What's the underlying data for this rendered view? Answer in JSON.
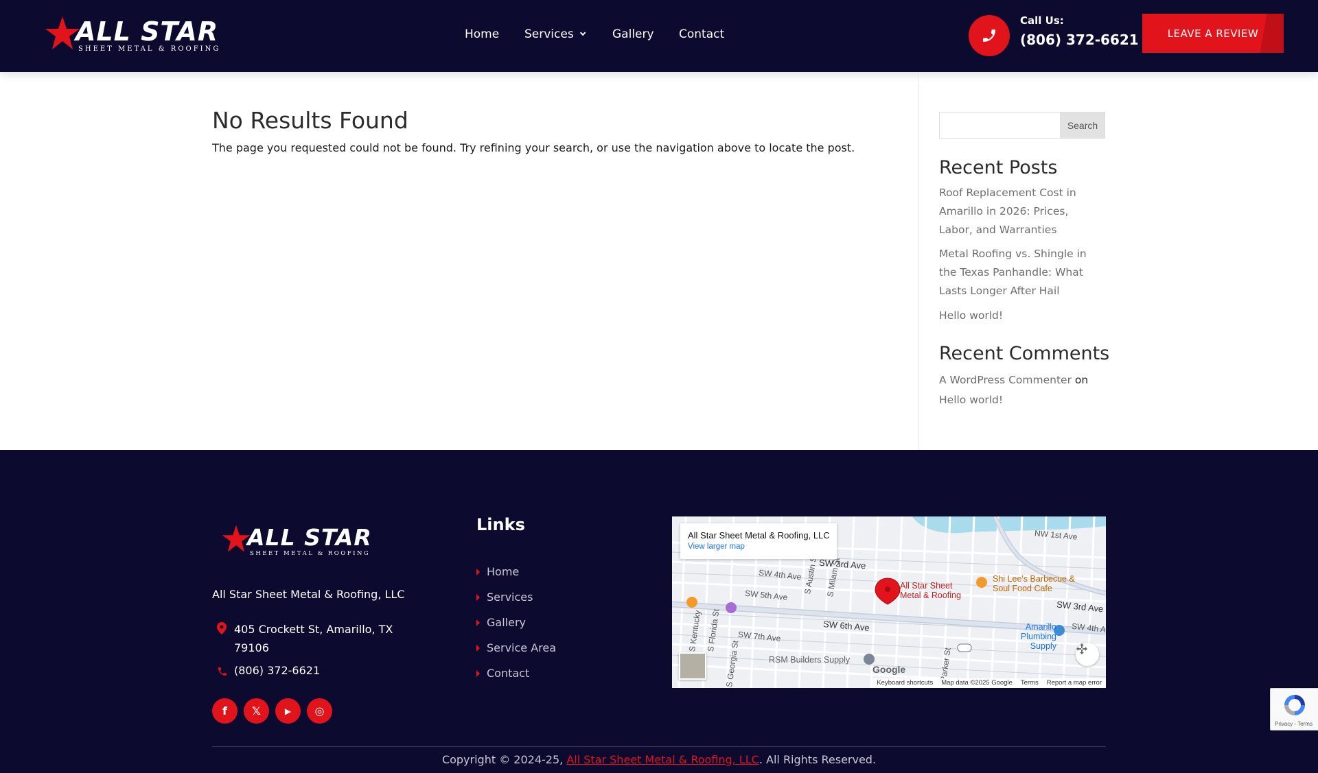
{
  "header": {
    "logo": {
      "brand": "ALL STAR",
      "tagline": "SHEET METAL & ROOFING"
    },
    "nav": [
      {
        "label": "Home"
      },
      {
        "label": "Services"
      },
      {
        "label": "Gallery"
      },
      {
        "label": "Contact"
      }
    ],
    "call_label": "Call Us:",
    "call_number": "(806) 372-6621",
    "review_button": "LEAVE A REVIEW"
  },
  "main": {
    "title": "No Results Found",
    "message": "The page you requested could not be found. Try refining your search, or use the navigation above to locate the post."
  },
  "sidebar": {
    "search_placeholder": "",
    "search_button": "Search",
    "recent_posts_heading": "Recent Posts",
    "recent_posts": [
      {
        "title": "Roof Replacement Cost in Amarillo in 2026: Prices, Labor, and Warranties"
      },
      {
        "title": "Metal Roofing vs. Shingle in the Texas Panhandle: What Lasts Longer After Hail"
      },
      {
        "title": "Hello world!"
      }
    ],
    "recent_comments_heading": "Recent Comments",
    "comment": {
      "author": "A WordPress Commenter",
      "connector": "on",
      "post": "Hello world!"
    }
  },
  "footer": {
    "logo": {
      "brand": "ALL STAR",
      "tagline": "SHEET METAL & ROOFING"
    },
    "company": "All Star Sheet Metal & Roofing, LLC",
    "address": "405 Crockett St, Amarillo, TX 79106",
    "phone": "(806) 372-6621",
    "links_heading": "Links",
    "links": [
      {
        "label": "Home"
      },
      {
        "label": "Services"
      },
      {
        "label": "Gallery"
      },
      {
        "label": "Service Area"
      },
      {
        "label": "Contact"
      }
    ],
    "socials": [
      {
        "icon": "facebook-icon",
        "glyph": "f"
      },
      {
        "icon": "x-icon",
        "glyph": "𝕏"
      },
      {
        "icon": "youtube-icon",
        "glyph": "▶"
      },
      {
        "icon": "instagram-icon",
        "glyph": "◎"
      }
    ],
    "map": {
      "place_name": "All Star Sheet Metal & Roofing, LLC",
      "view_larger": "View larger map",
      "streets": [
        "SW 3rd Ave",
        "SW 4th Ave",
        "SW 5th Ave",
        "SW 6th Ave",
        "SW 7th Ave",
        "S Austin St",
        "S Milam St",
        "S Georgia St",
        "S Florida St",
        "S Kentucky",
        "Parker St",
        "NW 1st Ave",
        "SW 3rd Ave",
        "SW 4th Ave"
      ],
      "pin_label": "All Star Sheet Metal & Roofing",
      "poi_bbq": "Shi Lee's Barbecue & Soul Food Cafe",
      "poi_plumbing": "Amarillo Plumbing Supply",
      "poi_rsm": "RSM Builders Supply",
      "google": "Google",
      "footer_items": [
        "Keyboard shortcuts",
        "Map data ©2025 Google",
        "Terms",
        "Report a map error"
      ]
    },
    "copyright_prefix": "Copyright © 2024-25,",
    "copyright_link": "All Star Sheet Metal & Roofing, LLC",
    "copyright_suffix": ". All Rights Reserved."
  },
  "recaptcha": {
    "label": "Privacy - Terms"
  },
  "colors": {
    "navy": "#0c0a2e",
    "accent_red": "#e1141c"
  }
}
